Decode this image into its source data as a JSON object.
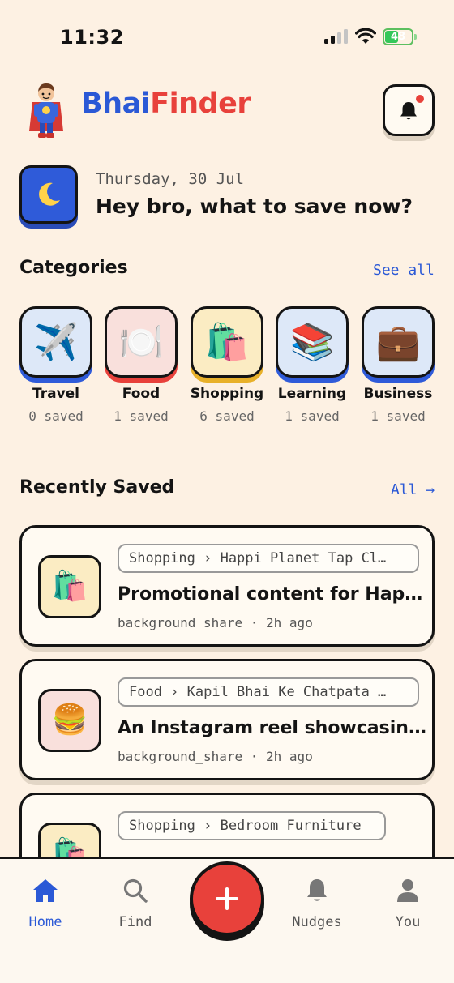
{
  "status_bar": {
    "time": "11:32",
    "battery": "48",
    "battery_level": 0.48
  },
  "header": {
    "brand_part1": "Bhai",
    "brand_part2": "Finder",
    "icons": {
      "mascot": "superhero-mascot-icon",
      "notifications": "bell-icon"
    },
    "notification_badge": true
  },
  "greeting": {
    "date": "Thursday, 30 Jul",
    "title": "Hey bro, what to save now?",
    "icon": "moon-icon"
  },
  "categories": {
    "title": "Categories",
    "see_all": "See all",
    "items": [
      {
        "name": "Travel",
        "count": "0 saved",
        "emoji": "✈️",
        "icon": "airplane-icon",
        "bg": "#dde8f8",
        "accent": "#2f5bd9"
      },
      {
        "name": "Food",
        "count": "1 saved",
        "emoji": "🍽️",
        "icon": "plate-icon",
        "bg": "#f9e0dc",
        "accent": "#e8413b"
      },
      {
        "name": "Shopping",
        "count": "6 saved",
        "emoji": "🛍️",
        "icon": "shopping-bags-icon",
        "bg": "#fbecc3",
        "accent": "#e8b12a"
      },
      {
        "name": "Learning",
        "count": "1 saved",
        "emoji": "📚",
        "icon": "books-icon",
        "bg": "#dde8f8",
        "accent": "#2f5bd9"
      },
      {
        "name": "Business",
        "count": "1 saved",
        "emoji": "💼",
        "icon": "briefcase-icon",
        "bg": "#dde8f8",
        "accent": "#2f5bd9"
      }
    ]
  },
  "recent": {
    "title": "Recently Saved",
    "all_link": "All →",
    "items": [
      {
        "crumb": "Shopping › Happi Planet Tap Cl…",
        "title": "Promotional content for Hap…",
        "meta": "background_share · 2h ago",
        "emoji": "🛍️",
        "icon": "shopping-bags-icon",
        "bg": "#fbecc3"
      },
      {
        "crumb": "Food › Kapil Bhai Ke Chatpata …",
        "title": "An Instagram reel showcasin…",
        "meta": "background_share · 2h ago",
        "emoji": "🍔",
        "icon": "burger-icon",
        "bg": "#f9e0dc"
      },
      {
        "crumb": "Shopping › Bedroom Furniture",
        "title": "",
        "meta": "",
        "emoji": "🛍️",
        "icon": "shopping-bags-icon",
        "bg": "#fbecc3"
      }
    ]
  },
  "nav": {
    "items": [
      {
        "label": "Home",
        "icon": "home-icon",
        "active": true
      },
      {
        "label": "Find",
        "icon": "search-icon",
        "active": false
      },
      {
        "label": "Nudges",
        "icon": "bell-icon",
        "active": false
      },
      {
        "label": "You",
        "icon": "person-icon",
        "active": false
      }
    ],
    "fab_icon": "plus-icon"
  },
  "colors": {
    "background": "#fdf1e3",
    "accent_blue": "#2b59d6",
    "accent_red": "#e8413b",
    "ink": "#141414"
  }
}
